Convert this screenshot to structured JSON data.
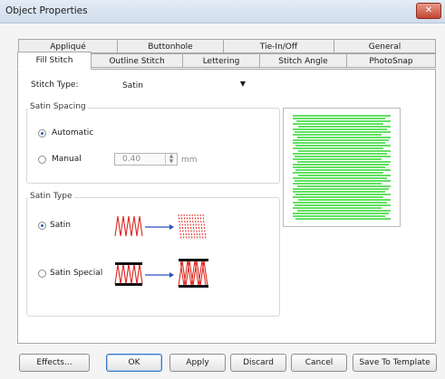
{
  "window": {
    "title": "Object Properties",
    "close_label": "✕"
  },
  "tabs_row1": [
    "Appliqué",
    "Buttonhole",
    "Tie-In/Off",
    "General"
  ],
  "tabs_row2": [
    "Fill Stitch",
    "Outline Stitch",
    "Lettering",
    "Stitch Angle",
    "PhotoSnap"
  ],
  "active_tab": "Fill Stitch",
  "stitch_type": {
    "label": "Stitch Type:",
    "value": "Satin"
  },
  "satin_spacing": {
    "title": "Satin Spacing",
    "automatic_label": "Automatic",
    "manual_label": "Manual",
    "manual_value": "0.40",
    "unit": "mm",
    "selected": "Automatic"
  },
  "satin_type": {
    "title": "Satin Type",
    "satin_label": "Satin",
    "special_label": "Satin Special",
    "selected": "Satin"
  },
  "colors": {
    "stitch_green": "#2fd62f",
    "diagram_red": "#e0261f",
    "arrow_blue": "#2a4fc8"
  },
  "buttons": {
    "effects": "Effects...",
    "ok": "OK",
    "apply": "Apply",
    "discard": "Discard",
    "cancel": "Cancel",
    "save_template": "Save To Template"
  }
}
